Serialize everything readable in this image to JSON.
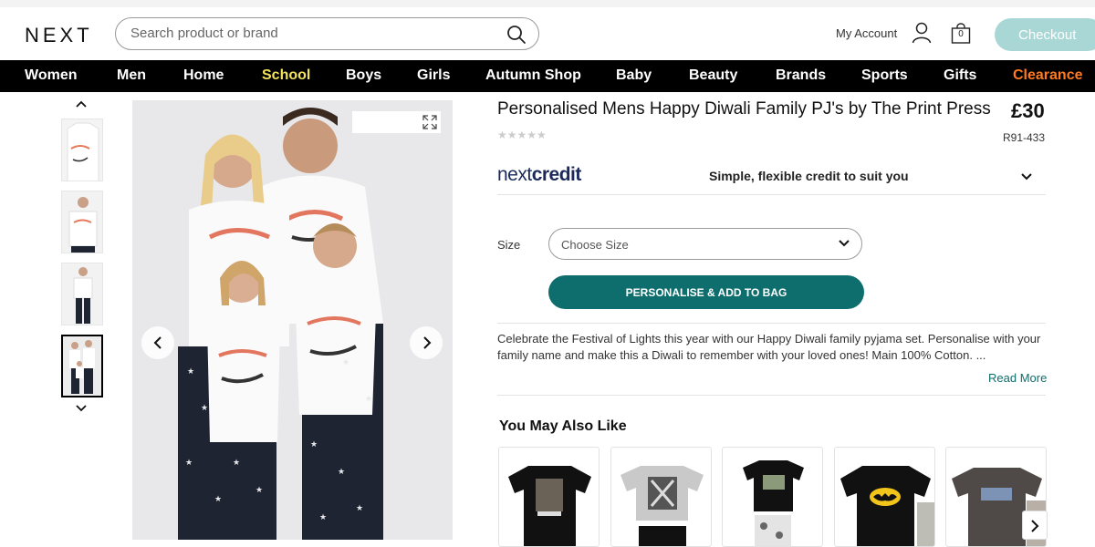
{
  "header": {
    "logo": "NEXT",
    "search_placeholder": "Search product or brand",
    "account_label": "My Account",
    "bag_count": "0",
    "checkout_label": "Checkout",
    "checkout_color": "#a9d7d5"
  },
  "nav": {
    "items": [
      {
        "label": "Women",
        "color": "#ffffff"
      },
      {
        "label": "Men",
        "color": "#ffffff"
      },
      {
        "label": "Home",
        "color": "#ffffff"
      },
      {
        "label": "School",
        "color": "#f2e35a"
      },
      {
        "label": "Boys",
        "color": "#ffffff"
      },
      {
        "label": "Girls",
        "color": "#ffffff"
      },
      {
        "label": "Autumn Shop",
        "color": "#ffffff"
      },
      {
        "label": "Baby",
        "color": "#ffffff"
      },
      {
        "label": "Beauty",
        "color": "#ffffff"
      },
      {
        "label": "Brands",
        "color": "#ffffff"
      },
      {
        "label": "Sports",
        "color": "#ffffff"
      },
      {
        "label": "Gifts",
        "color": "#ffffff"
      },
      {
        "label": "Clearance",
        "color": "#ff7a21"
      }
    ]
  },
  "gallery": {
    "thumbnail_count": 4,
    "active_thumbnail": 4
  },
  "product": {
    "title": "Personalised Mens Happy Diwali Family PJ's by The Print Press",
    "price": "£30",
    "rating_stars": "★★★★★",
    "item_code": "R91-433",
    "credit_logo_light": "next",
    "credit_logo_bold": "credit",
    "credit_text": "Simple, flexible credit to suit you",
    "size_label": "Size",
    "size_placeholder": "Choose Size",
    "add_button": "PERSONALISE & ADD TO BAG",
    "description": "Celebrate the Festival of Lights this year with our Happy Diwali family pyjama set. Personalise with your family name and make this a Diwali to remember with your loved ones! Main 100% Cotton. ...",
    "read_more": "Read More",
    "accent_color": "#0e6e6e"
  },
  "recommendations": {
    "heading": "You May Also Like",
    "items": [
      {
        "icon": "mandalorian-tshirt-icon"
      },
      {
        "icon": "grey-graphic-tshirt-icon"
      },
      {
        "icon": "do-not-disturb-pj-icon"
      },
      {
        "icon": "batman-tshirt-icon"
      },
      {
        "icon": "star-wars-tshirt-icon"
      }
    ]
  }
}
